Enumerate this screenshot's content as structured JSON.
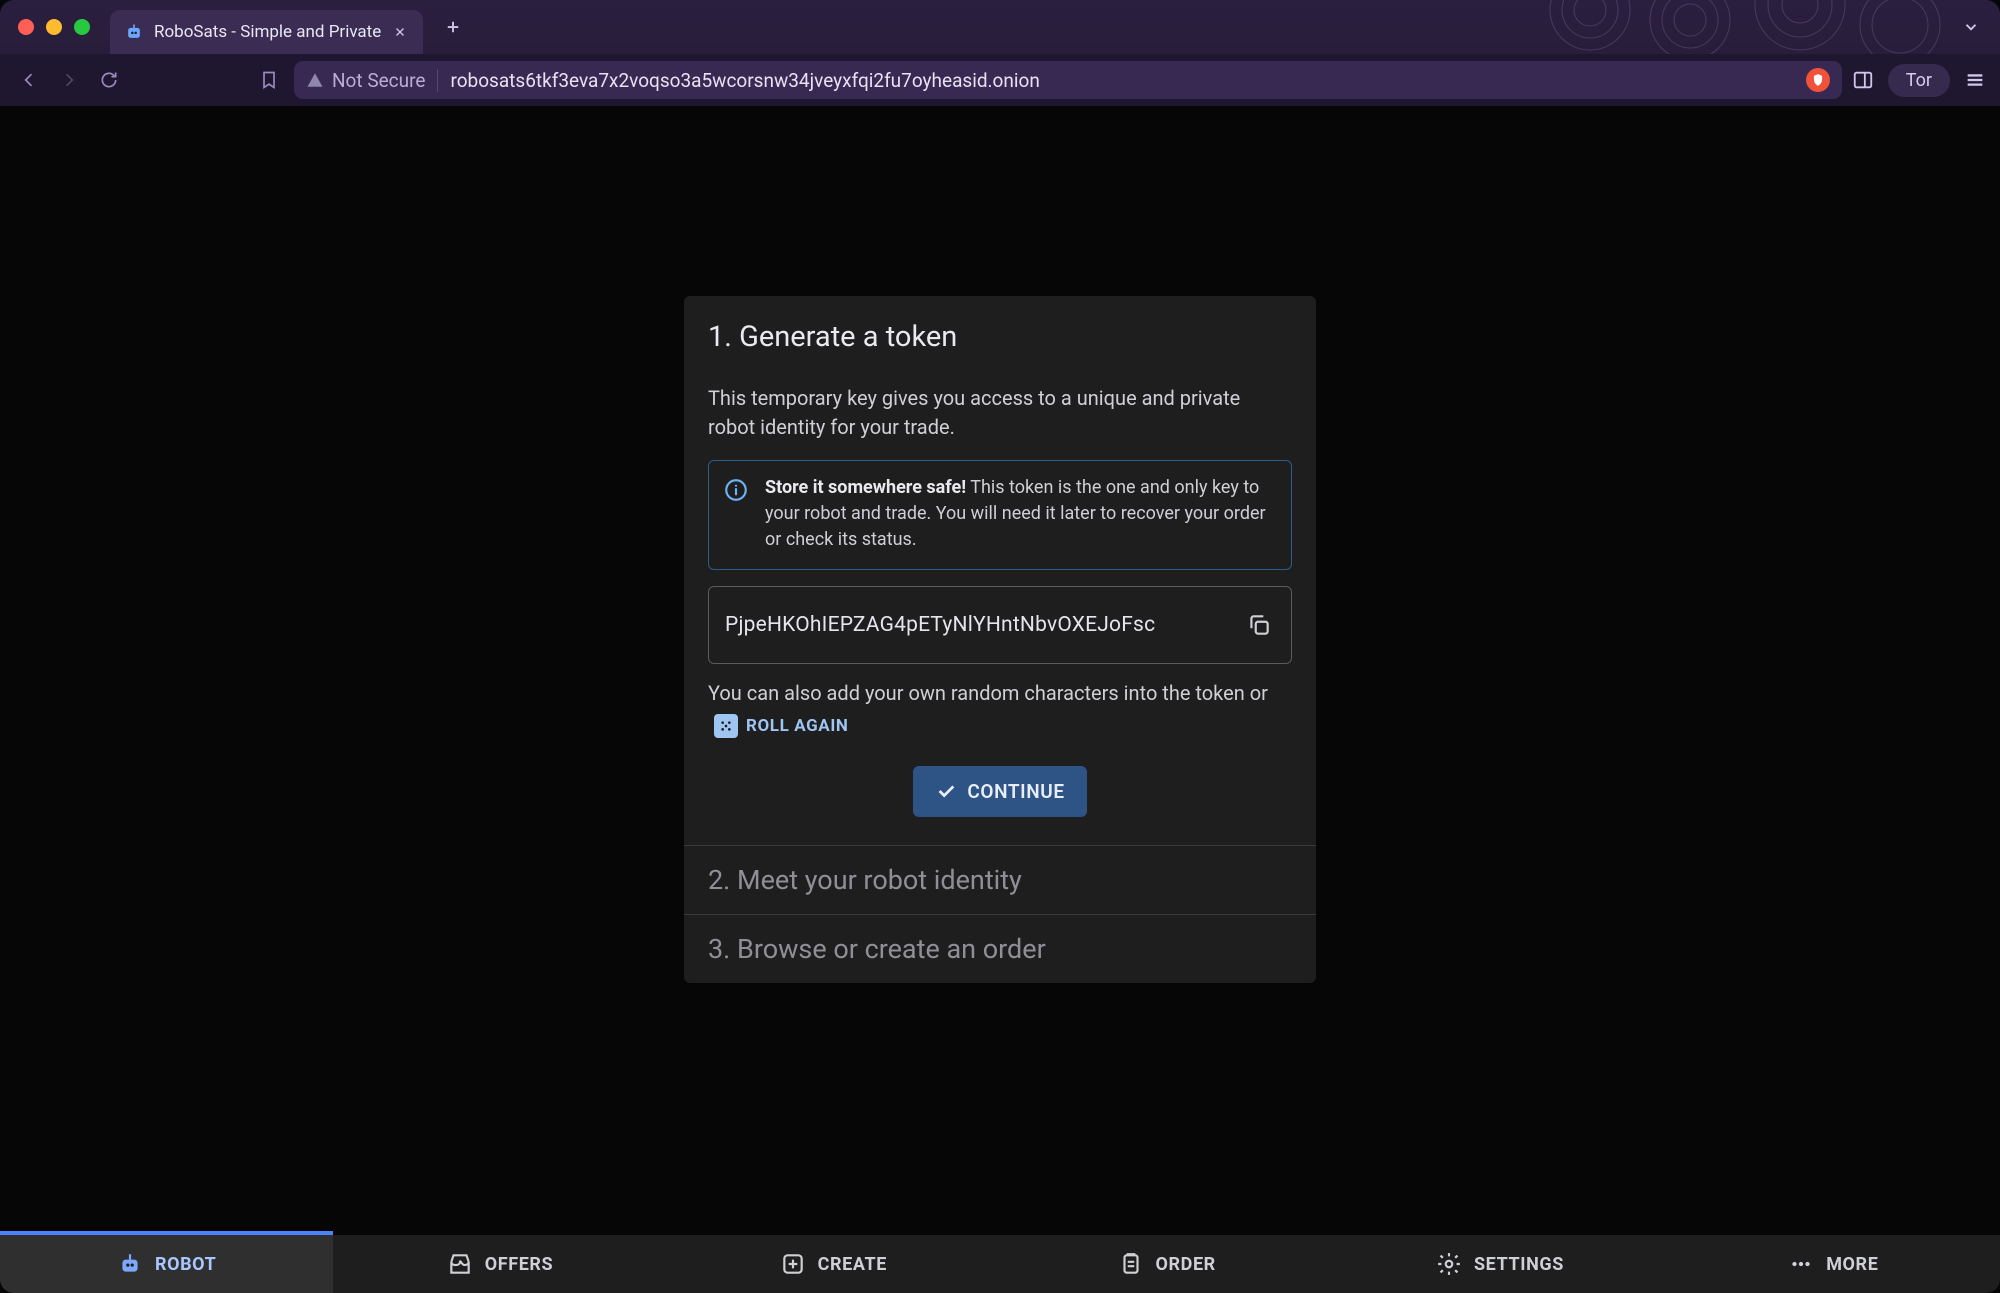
{
  "browser": {
    "tab_title": "RoboSats - Simple and Private",
    "not_secure_label": "Not Secure",
    "url": "robosats6tkf3eva7x2voqso3a5wcorsnw34jveyxfqi2fu7oyheasid.onion",
    "tor_label": "Tor"
  },
  "step1": {
    "title": "1. Generate a token",
    "lead": "This temporary key gives you access to a unique and private robot identity for your trade.",
    "alert_strong": "Store it somewhere safe!",
    "alert_rest": " This token is the one and only key to your robot and trade. You will need it later to recover your order or check its status.",
    "token": "PjpeHKOhIEPZAG4pETyNlYHntNbvOXEJoFsc",
    "after_a": "You can also add your own random characters into the token or ",
    "roll_label": "ROLL AGAIN",
    "continue_label": "CONTINUE"
  },
  "step2": {
    "title": "2. Meet your robot identity"
  },
  "step3": {
    "title": "3. Browse or create an order"
  },
  "nav": {
    "robot": "ROBOT",
    "offers": "OFFERS",
    "create": "CREATE",
    "order": "ORDER",
    "settings": "SETTINGS",
    "more": "MORE"
  }
}
